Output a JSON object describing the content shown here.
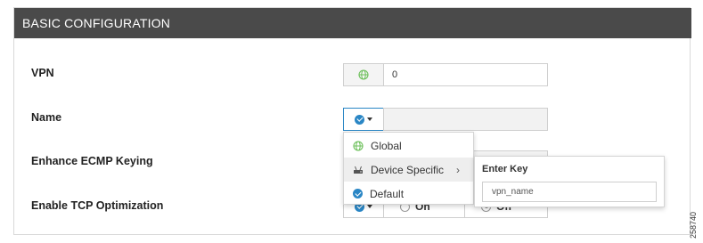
{
  "panel": {
    "title": "BASIC CONFIGURATION"
  },
  "rows": [
    {
      "label": "VPN",
      "scope_icon": "globe-icon",
      "value": "0"
    },
    {
      "label": "Name",
      "scope_icon": "check-circle-icon",
      "value": ""
    },
    {
      "label": "Enhance ECMP Keying"
    },
    {
      "label": "Enable TCP Optimization",
      "scope_icon": "check-circle-icon",
      "radio_options": [
        {
          "label": "On",
          "selected": false
        },
        {
          "label": "Off",
          "selected": true
        }
      ]
    }
  ],
  "scope_menu": {
    "items": [
      {
        "label": "Global",
        "icon": "globe-icon"
      },
      {
        "label": "Device Specific",
        "icon": "router-icon",
        "has_submenu": true
      },
      {
        "label": "Default",
        "icon": "check-circle-icon"
      }
    ],
    "submenu": {
      "title": "Enter Key",
      "input_value": "vpn_name"
    }
  },
  "figure_number": "258740",
  "colors": {
    "header_bg": "#4a4a4a",
    "accent_blue": "#2a86c5",
    "globe_green": "#6bbf59"
  }
}
